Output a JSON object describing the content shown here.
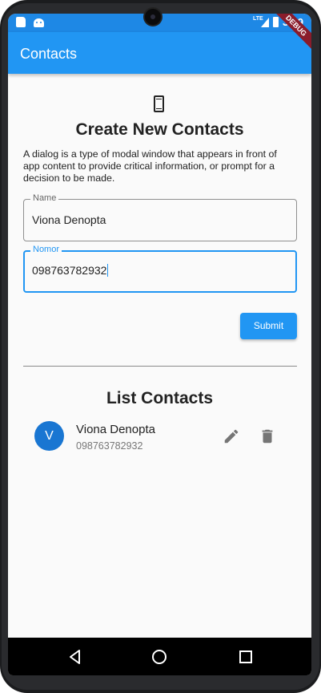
{
  "status_bar": {
    "network": "LTE",
    "time": "3:59"
  },
  "debug_banner": "DEBUG",
  "app_bar": {
    "title": "Contacts"
  },
  "form": {
    "icon": "smartphone-icon",
    "title": "Create New Contacts",
    "description": "A dialog is a type of modal window that appears in front of app content to provide critical information, or prompt for a decision to be made.",
    "name_field": {
      "label": "Name",
      "value": "Viona Denopta"
    },
    "number_field": {
      "label": "Nomor",
      "value": "098763782932"
    },
    "submit_label": "Submit"
  },
  "list": {
    "title": "List Contacts",
    "contacts": [
      {
        "initial": "V",
        "name": "Viona Denopta",
        "number": "098763782932"
      }
    ]
  },
  "colors": {
    "primary": "#2196f3",
    "status_bar": "#1e88e5",
    "avatar": "#1976d2",
    "debug": "#8a1c2b"
  },
  "nav_icons": [
    "back-icon",
    "home-icon",
    "recents-icon"
  ]
}
